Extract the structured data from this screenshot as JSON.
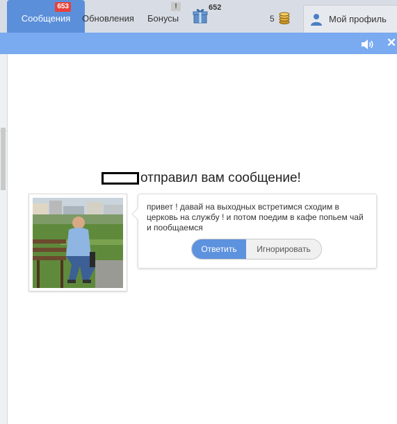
{
  "header": {
    "tabs": {
      "messages": "Сообщения",
      "messages_badge": "653",
      "updates": "Обновления",
      "bonuses": "Бонусы",
      "bonuses_badge": "!"
    },
    "gift_count": "652",
    "coins_count": "5",
    "profile_label": "Мой профиль"
  },
  "toolbar": {
    "close_glyph": "✕"
  },
  "notification": {
    "heading": "отправил вам сообщение!",
    "message": "привет ! давай на выходных встретимся сходим в церковь на службу ! и потом поедим в кафе попьем чай и пообщаемся",
    "reply_label": "Ответить",
    "ignore_label": "Игнорировать"
  },
  "colors": {
    "accent": "#5b8fd9",
    "bar": "#7aaaf0",
    "badge": "#e8403a"
  }
}
